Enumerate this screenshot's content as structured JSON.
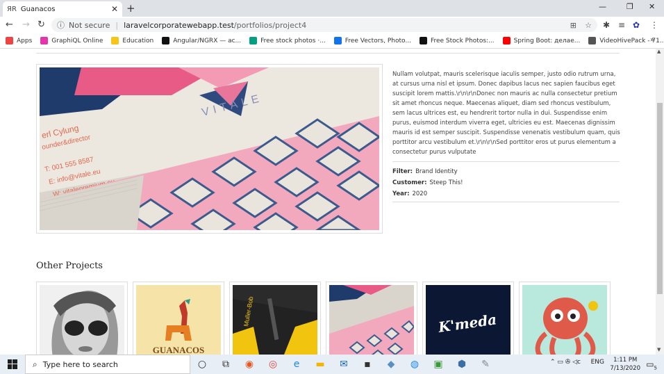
{
  "browser": {
    "tab_title": "Guanacos",
    "url_host": "laravelcorporatewebapp.test",
    "url_path": "/portfolios/project4",
    "security": "Not secure"
  },
  "bookmarks": [
    {
      "label": "Apps",
      "color": "#e44"
    },
    {
      "label": "GraphiQL Online",
      "color": "#e535ab"
    },
    {
      "label": "Education",
      "color": "#f5c518"
    },
    {
      "label": "Angular/NGRX — ас...",
      "color": "#111"
    },
    {
      "label": "Free stock photos ·...",
      "color": "#05a081"
    },
    {
      "label": "Free Vectors, Photo...",
      "color": "#1273eb"
    },
    {
      "label": "Free Stock Photos:...",
      "color": "#111"
    },
    {
      "label": "Spring Boot: делае...",
      "color": "#ff0000"
    },
    {
      "label": "VideoHivePack - 71...",
      "color": "#555"
    }
  ],
  "project": {
    "description": "Nullam volutpat, mauris scelerisque iaculis semper, justo odio rutrum urna, at cursus urna nisl et ipsum. Donec dapibus lacus nec sapien faucibus eget suscipit lorem mattis.\\r\\n\\r\\nDonec non mauris ac nulla consectetur pretium sit amet rhoncus neque. Maecenas aliquet, diam sed rhoncus vestibulum, sem lacus ultrices est, eu hendrerit tortor nulla in dui. Suspendisse enim purus, euismod interdum viverra eget, ultricies eu est. Maecenas dignissim mauris id est semper suscipit. Suspendisse venenatis vestibulum quam, quis porttitor arcu vestibulum et.\\r\\n\\r\\nSed porttitor eros ut purus elementum a consectetur purus vulputate",
    "filter_label": "Filter:",
    "filter": "Brand Identity",
    "customer_label": "Customer:",
    "customer": "Steep This!",
    "year_label": "Year:",
    "year": "2020",
    "card_name": "erl Cylung",
    "card_role": "ounder&director",
    "card_phone": "T: 001 555 8587",
    "card_email": "E: info@vitale.eu",
    "card_web": "W: vitalepremium.eu",
    "card_brand": "VITALE"
  },
  "other_projects": {
    "heading": "Other Projects",
    "thumb_texts": [
      "GUANACOS",
      "Muller-Bob",
      "K'meda"
    ]
  },
  "taskbar": {
    "search_placeholder": "Type here to search",
    "lang": "ENG",
    "time": "1:11 PM",
    "date": "7/13/2020",
    "notif_count": "5"
  }
}
